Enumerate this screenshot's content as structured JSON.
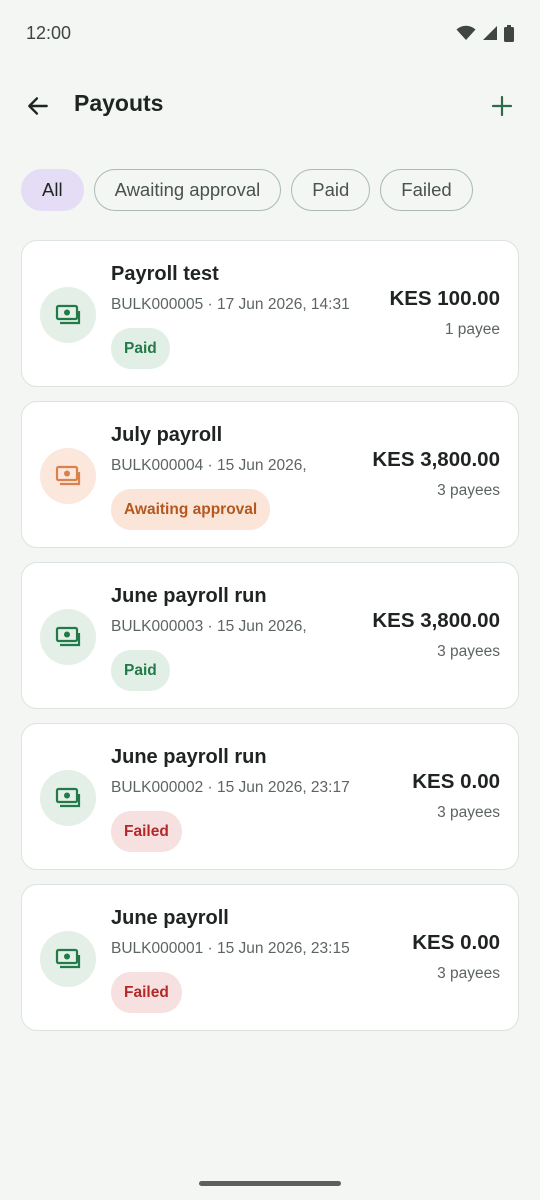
{
  "status_bar": {
    "time": "12:00",
    "icons": [
      "wifi-icon",
      "signal-icon",
      "battery-icon"
    ]
  },
  "app_bar": {
    "back_icon": "arrow-left-icon",
    "title": "Payouts",
    "add_icon": "plus-icon"
  },
  "filters": [
    {
      "label": "All",
      "selected": true
    },
    {
      "label": "Awaiting approval",
      "selected": false
    },
    {
      "label": "Paid",
      "selected": false
    },
    {
      "label": "Failed",
      "selected": false
    }
  ],
  "payouts": [
    {
      "title": "Payroll test",
      "meta": "BULK000005 · 17 Jun 2026, 14:31",
      "status": "Paid",
      "status_kind": "paid",
      "amount": "KES 100.00",
      "payees": "1 payee",
      "icon": "money-icon"
    },
    {
      "title": "July payroll",
      "meta": "BULK000004 · 15 Jun 2026,",
      "status": "Awaiting approval",
      "status_kind": "awaiting",
      "amount": "KES 3,800.00",
      "payees": "3 payees",
      "icon": "money-icon"
    },
    {
      "title": "June payroll run",
      "meta": "BULK000003 · 15 Jun 2026,",
      "status": "Paid",
      "status_kind": "paid",
      "amount": "KES 3,800.00",
      "payees": "3 payees",
      "icon": "money-icon"
    },
    {
      "title": "June payroll run",
      "meta": "BULK000002 · 15 Jun 2026, 23:17",
      "status": "Failed",
      "status_kind": "failed",
      "amount": "KES 0.00",
      "payees": "3 payees",
      "icon": "money-icon"
    },
    {
      "title": "June payroll",
      "meta": "BULK000001 · 15 Jun 2026, 23:15",
      "status": "Failed",
      "status_kind": "failed",
      "amount": "KES 0.00",
      "payees": "3 payees",
      "icon": "money-icon"
    }
  ],
  "colors": {
    "background": "#f3f6f3",
    "accent_selected_chip": "#e5dcf6",
    "paid": "#227a48",
    "awaiting": "#b4581f",
    "failed": "#b3292a",
    "icon_green": "#227a48",
    "icon_orange": "#d9824d"
  }
}
